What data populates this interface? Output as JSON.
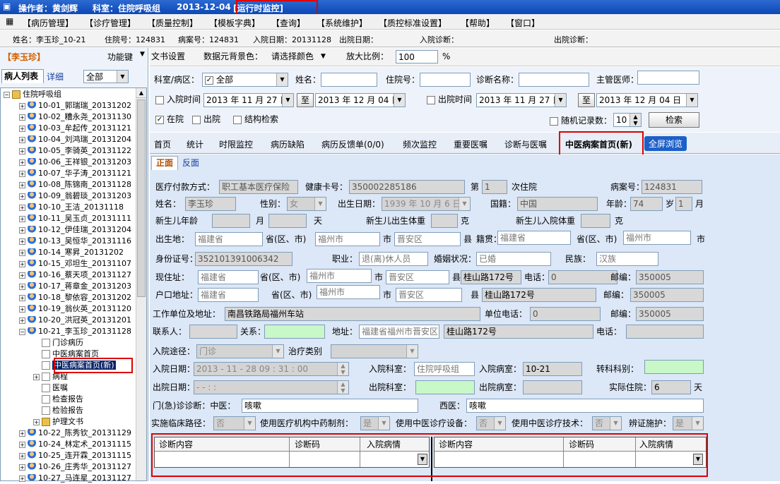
{
  "title": {
    "operator": "操作者：黄剑辉",
    "dept": "科室：住院呼吸组",
    "date": "2013-12-04",
    "mode": "[运行时监控]"
  },
  "menu": [
    "【病历管理】",
    "【诊疗管理】",
    "【质量控制】",
    "【模板字典】",
    "【查询】",
    "【系统维护】",
    "【质控标准设置】",
    "【帮助】",
    "【窗口】"
  ],
  "patient": {
    "name": "姓名：李玉珍_10-21",
    "inp_no": "住院号：124831",
    "case_no": "病案号：124831",
    "adm": "入院日期：20131128",
    "dis": "出院日期：",
    "adm_diag": "入院诊断：",
    "dis_diag": "出院诊断："
  },
  "left": {
    "patient_tag": "【李玉珍】",
    "func_key": "功能键",
    "tab_list": "病人列表",
    "tab_detail": "详细",
    "filter": "全部",
    "root": "住院呼吸组"
  },
  "tree": [
    "10-01_郭瑞瑞_20131202",
    "10-02_糟永尧_20131130",
    "10-03_牟起传_20131121",
    "10-04_刘鸿瑞_20131204",
    "10-05_李骑英_20131122",
    "10-06_王祥银_20131203",
    "10-07_华子涛_20131121",
    "10-08_陈锦南_20131128",
    "10-09_翁碧琰_20131203",
    "10-10_王洁_20131118",
    "10-11_吴玉贞_20131111",
    "10-12_伊佳瑞_20131204",
    "10-13_吴恒华_20131116",
    "10-14_寒昇_20131202",
    "10-15_邓坦生_20131107",
    "10-16_蔡天项_20131127",
    "10-17_蒋章金_20131203",
    "10-18_黎依容_20131202",
    "10-19_翁伙英_20131120",
    "10-20_洪冠英_20131201",
    "10-21_李玉珍_20131128"
  ],
  "subtree": [
    "门诊病历",
    "中医病案首页",
    "中医病案首页(新)",
    "病程",
    "医嘱",
    "检查报告",
    "检验报告",
    "护理文书"
  ],
  "tree2": [
    "10-22_陈秀钦_20131129",
    "10-24_林定术_20131115",
    "10-25_连开霖_20131115",
    "10-26_庄秀华_20131127",
    "10-27_马连星_20131127"
  ],
  "toolbar": {
    "doc_set": "文书设置",
    "bg": "数据元背景色：",
    "pick": "请选择颜色",
    "zoom": "放大比例：",
    "zoom_val": "100",
    "pct": "%"
  },
  "filter": {
    "dept": "科室/病区：",
    "all": "全部",
    "name": "姓名：",
    "inp": "住院号：",
    "diag": "诊断名称：",
    "doctor": "主管医师：",
    "adm_time": "入院时间",
    "d1": "2013 年 11 月 27 日",
    "to": "至",
    "d2": "2013 年 12 月 04 日",
    "dis_time": "出院时间",
    "in": "在院",
    "out": "出院",
    "struct": "结构检索",
    "rand": "随机记录数：",
    "rand_val": "10",
    "search": "检索"
  },
  "tabs": [
    "首页",
    "统计",
    "时限监控",
    "病历缺陷",
    "病历反馈单(0/0)",
    "频次监控",
    "重要医嘱",
    "诊断与医嘱",
    "中医病案首页(新)",
    "全屏浏览"
  ],
  "subtabs": [
    "正面",
    "反面"
  ],
  "form": {
    "pay": "医疗付款方式：",
    "pay_v": "职工基本医疗保险",
    "card": "健康卡号：",
    "card_v": "350002285186",
    "nth": "第",
    "nth_v": "1",
    "nth2": "次住院",
    "case": "病案号：",
    "case_v": "124831",
    "name": "姓名：",
    "name_v": "李玉珍",
    "sex": "性别：",
    "sex_v": "女",
    "birth": "出生日期：",
    "birth_v": "1939 年 10 月 6 日",
    "nat": "国籍：",
    "nat_v": "中国",
    "age": "年龄：",
    "age_v": "74",
    "sui": "岁",
    "mon_v": "1",
    "mon": "月",
    "nb_age": "新生儿年龄",
    "yue": "月",
    "tian": "天",
    "nb_bw": "新生儿出生体重",
    "ke": "克",
    "nb_aw": "新生儿入院体重",
    "ke2": "克",
    "bp": "出生地：",
    "prov": "福建省",
    "pcity": "省(区、市)",
    "city": "福州市",
    "shi": "市",
    "dist": "晋安区",
    "xian": "县",
    "native": "籍贯：",
    "prov2": "福建省",
    "pcity2": "省(区、市)",
    "city2": "福州市",
    "shi2": "市",
    "id": "身份证号：",
    "id_v": "352101391006342",
    "job": "职业：",
    "job_v": "退(离)休人员",
    "mar": "婚姻状况：",
    "mar_v": "已婚",
    "eth": "民族：",
    "eth_v": "汉族",
    "cur": "现住址：",
    "road": "桂山路172号",
    "tel": "电话：",
    "tel_v": "0",
    "zip": "邮编：",
    "zip_v": "350005",
    "hk": "户口地址：",
    "work": "工作单位及地址：",
    "work_v": "南昌铁路局福州车站",
    "wtel": "单位电话：",
    "wtel_v": "0",
    "contact": "联系人：",
    "rel": "关系：",
    "addr": "地址：",
    "addr_v": "福建省福州市晋安区",
    "phone": "电话：",
    "route": "入院途径：",
    "route_v": "门诊",
    "treat": "治疗类别",
    "adm_date": "入院日期：",
    "adm_date_v": "2013 - 11 - 28   09 : 31 : 00",
    "adm_dept": "入院科室：",
    "adm_dept_v": "住院呼吸组",
    "adm_ward": "入院病室：",
    "adm_ward_v": "10-21",
    "trans": "转科科别：",
    "dis_date": "出院日期：",
    "dis_date_v": "-    -         :       :",
    "dis_dept": "出院科室：",
    "dis_ward": "出院病室：",
    "days": "实际住院：",
    "days_v": "6",
    "tian2": "天",
    "op": "门(急)诊诊断：中医：",
    "op_v": "咳嗽",
    "west": "西医：",
    "west_v": "咳嗽",
    "path": "实施临床路径：",
    "no": "否",
    "herb": "使用医疗机构中药制剂：",
    "yes": "是",
    "equip": "使用中医诊疗设备：",
    "tech": "使用中医诊疗技术：",
    "bz": "辨证施护：",
    "g_col1": "诊断内容",
    "g_col2": "诊断码",
    "g_col3": "入院病情"
  }
}
